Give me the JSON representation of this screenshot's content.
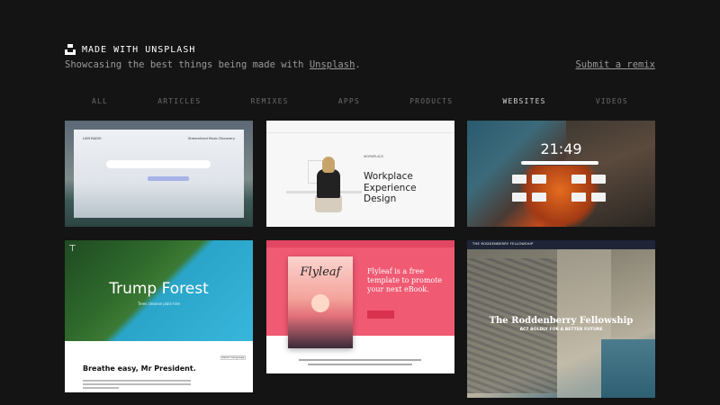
{
  "header": {
    "brand": "MADE WITH UNSPLASH",
    "tagline_prefix": "Showcasing the best things being made with ",
    "tagline_link": "Unsplash",
    "tagline_suffix": ".",
    "remix_link": "Submit a remix"
  },
  "filters": [
    {
      "label": "ALL",
      "active": false
    },
    {
      "label": "ARTICLES",
      "active": false
    },
    {
      "label": "REMIXES",
      "active": false
    },
    {
      "label": "APPS",
      "active": false
    },
    {
      "label": "PRODUCTS",
      "active": false
    },
    {
      "label": "WEBSITES",
      "active": true
    },
    {
      "label": "VIDEOS",
      "active": false
    }
  ],
  "cards": {
    "lisn": {
      "brand": "LISN RADIO",
      "right": "Streamlined Music Discovery"
    },
    "workplace": {
      "brand": "WORKPLACE",
      "headline_1": "Workplace",
      "headline_2": "Experience",
      "headline_3": "Design"
    },
    "clock": {
      "time": "21:49"
    },
    "trump": {
      "title": "Trump Forest",
      "subtitle": "Trees cleanse plain hire",
      "lang": "Select Language",
      "heading": "Breathe easy, Mr President."
    },
    "flyleaf": {
      "book_title": "Flyleaf",
      "line1": "Flyleaf is a free",
      "line2": "template to promote",
      "line3": "your next eBook."
    },
    "roddenberry": {
      "nav_brand": "THE RODDENBERRY FELLOWSHIP",
      "title": "The Roddenberry Fellowship",
      "subtitle": "ACT BOLDLY FOR A BETTER FUTURE"
    }
  }
}
